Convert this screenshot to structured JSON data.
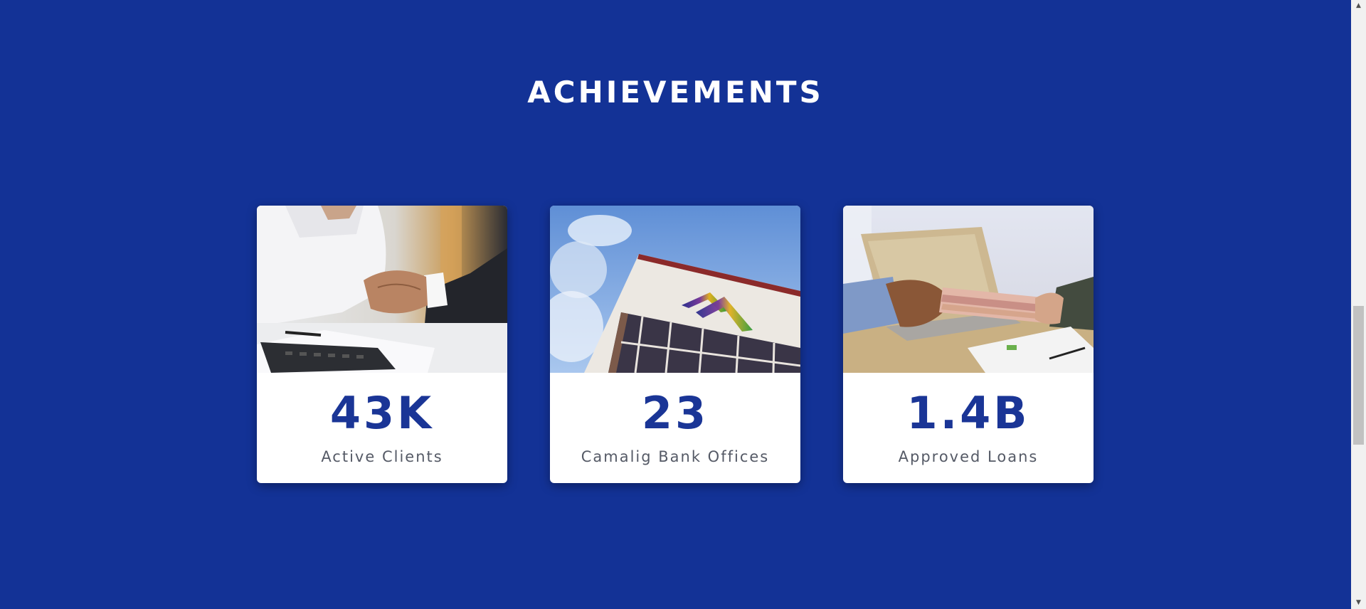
{
  "section": {
    "title": "ACHIEVEMENTS"
  },
  "cards": [
    {
      "value": "43K",
      "label": "Active Clients",
      "image": "handshake-photo"
    },
    {
      "value": "23",
      "label": "Camalig Bank Offices",
      "image": "bank-building-photo"
    },
    {
      "value": "1.4B",
      "label": "Approved Loans",
      "image": "cash-handover-photo"
    }
  ],
  "colors": {
    "background": "#133296",
    "value_text": "#1a3596",
    "label_text": "#555a66",
    "card": "#ffffff"
  },
  "scrollbar": {
    "up_icon": "triangle-up-icon",
    "down_icon": "triangle-down-icon"
  }
}
